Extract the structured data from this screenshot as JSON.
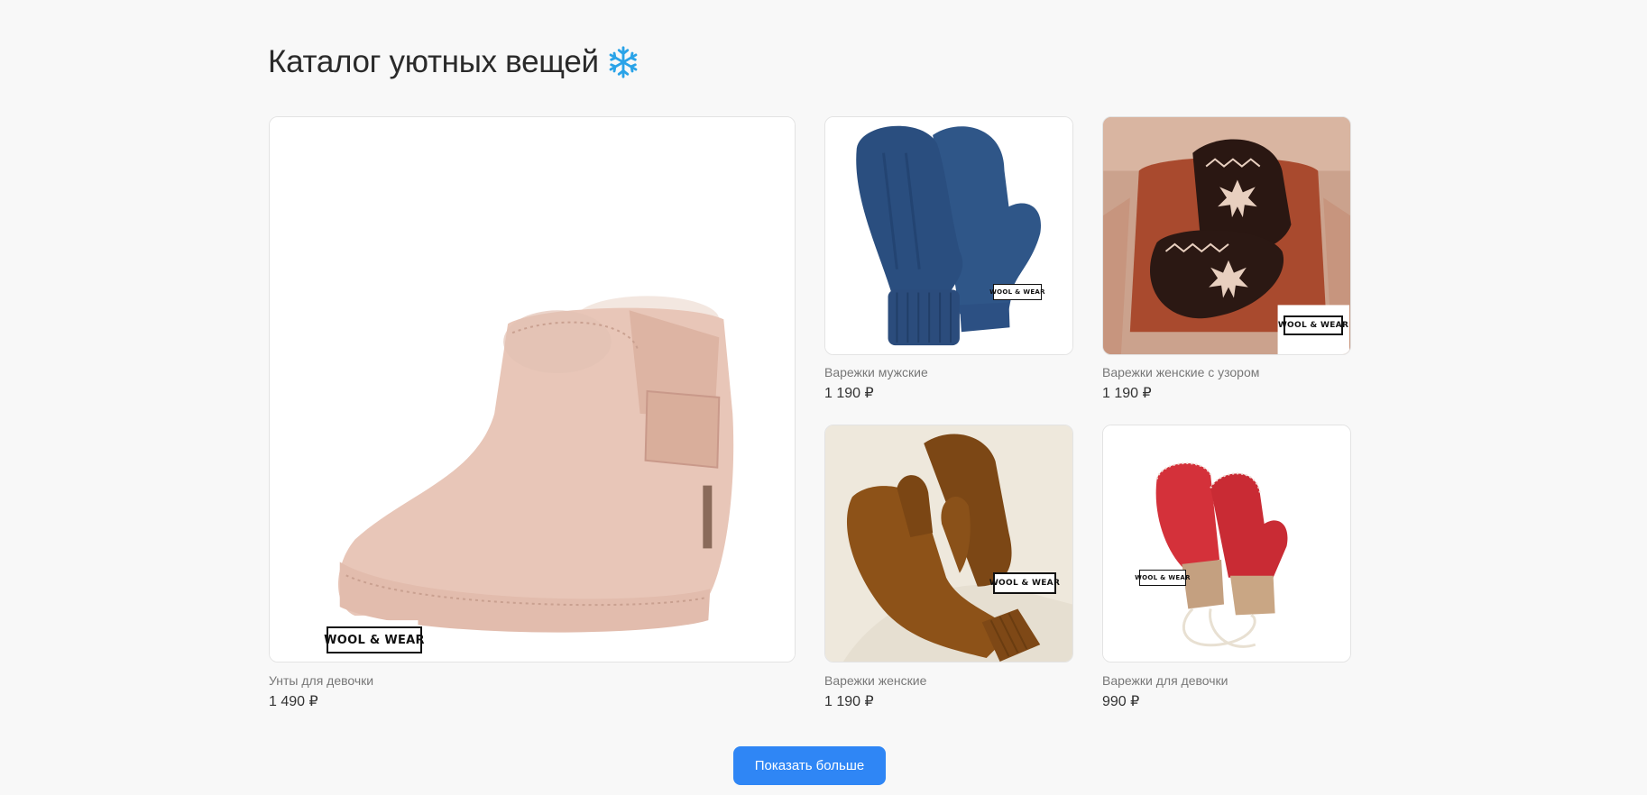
{
  "page": {
    "title": "Каталог уютных вещей",
    "title_icon": "snowflake-icon"
  },
  "products": [
    {
      "name": "Унты для девочки",
      "price": "1 490 ₽",
      "image": "pink-baby-boot",
      "logo": "WOOL & WEAR"
    },
    {
      "name": "Варежки мужские",
      "price": "1 190 ₽",
      "image": "blue-knit-mittens",
      "logo": "WOOL & WEAR"
    },
    {
      "name": "Варежки женские с узором",
      "price": "1 190 ₽",
      "image": "black-patterned-mittens",
      "logo": "WOOL & WEAR"
    },
    {
      "name": "Варежки женские",
      "price": "1 190 ₽",
      "image": "brown-knit-mittens",
      "logo": "WOOL & WEAR"
    },
    {
      "name": "Варежки для девочки",
      "price": "990 ₽",
      "image": "red-leather-mittens",
      "logo": "WOOL & WEAR"
    }
  ],
  "actions": {
    "show_more_label": "Показать больше"
  },
  "colors": {
    "accent": "#2f86f5",
    "background": "#f8f8f8",
    "snowflake": "#2aa3e8"
  }
}
